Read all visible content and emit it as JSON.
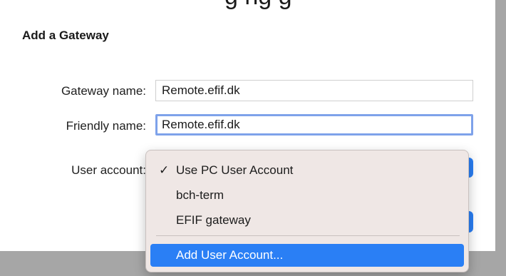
{
  "top_text": "g   ng   g",
  "dialog": {
    "title": "Add a Gateway",
    "gateway_name_label": "Gateway name:",
    "gateway_name_value": "Remote.efif.dk",
    "friendly_name_label": "Friendly name:",
    "friendly_name_value": "Remote.efif.dk",
    "user_account_label": "User account:"
  },
  "menu": {
    "items": [
      {
        "label": "Use PC User Account",
        "checked": true
      },
      {
        "label": "bch-term",
        "checked": false
      },
      {
        "label": "EFIF gateway",
        "checked": false
      }
    ],
    "action_item": "Add User Account...",
    "check_glyph": "✓"
  },
  "colors": {
    "accent": "#2a7ff5",
    "menu_background": "#efe7e5",
    "focus_ring": "#7ea2ea",
    "backdrop": "#a6a6a6"
  }
}
